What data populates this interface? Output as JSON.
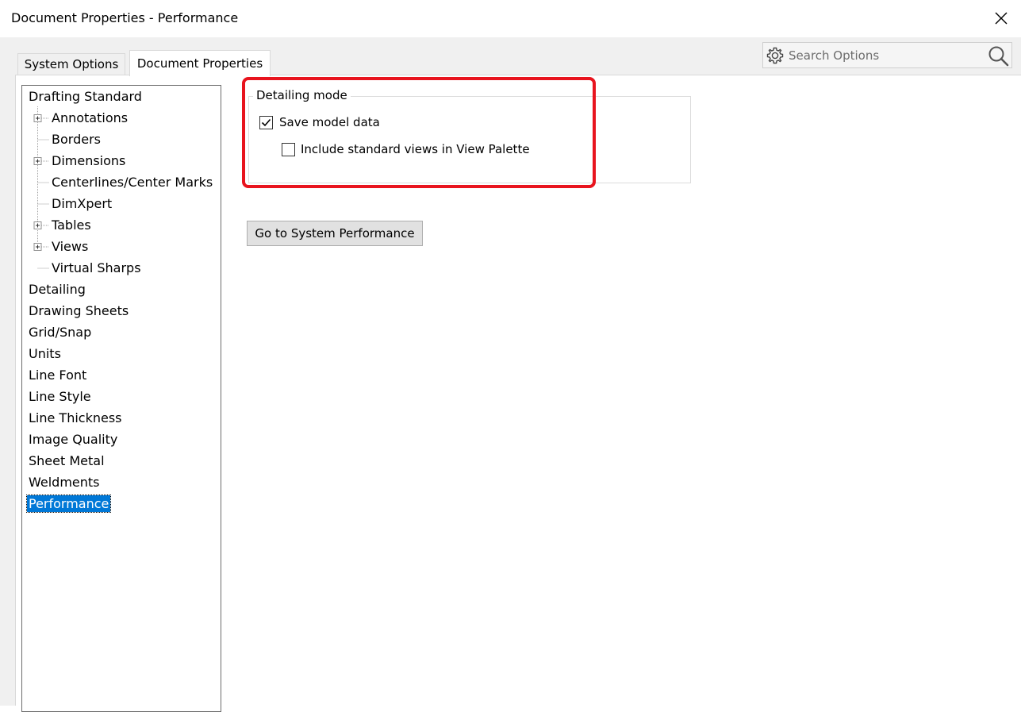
{
  "window": {
    "title": "Document Properties - Performance"
  },
  "tabs": [
    {
      "label": "System Options",
      "active": false
    },
    {
      "label": "Document Properties",
      "active": true
    }
  ],
  "search": {
    "placeholder": "Search Options"
  },
  "tree": {
    "items": [
      {
        "label": "Drafting Standard",
        "level": 0
      },
      {
        "label": "Annotations",
        "level": 1,
        "expandable": true
      },
      {
        "label": "Borders",
        "level": 1
      },
      {
        "label": "Dimensions",
        "level": 1,
        "expandable": true
      },
      {
        "label": "Centerlines/Center Marks",
        "level": 1
      },
      {
        "label": "DimXpert",
        "level": 1
      },
      {
        "label": "Tables",
        "level": 1,
        "expandable": true
      },
      {
        "label": "Views",
        "level": 1,
        "expandable": true
      },
      {
        "label": "Virtual Sharps",
        "level": 1
      },
      {
        "label": "Detailing",
        "level": 0
      },
      {
        "label": "Drawing Sheets",
        "level": 0
      },
      {
        "label": "Grid/Snap",
        "level": 0
      },
      {
        "label": "Units",
        "level": 0
      },
      {
        "label": "Line Font",
        "level": 0
      },
      {
        "label": "Line Style",
        "level": 0
      },
      {
        "label": "Line Thickness",
        "level": 0
      },
      {
        "label": "Image Quality",
        "level": 0
      },
      {
        "label": "Sheet Metal",
        "level": 0
      },
      {
        "label": "Weldments",
        "level": 0
      },
      {
        "label": "Performance",
        "level": 0,
        "selected": true
      }
    ]
  },
  "detailing_mode": {
    "title": "Detailing mode",
    "save_model_data": {
      "label": "Save model data",
      "checked": true
    },
    "include_standard_views": {
      "label": "Include standard views in View Palette",
      "checked": false
    }
  },
  "buttons": {
    "system_performance": "Go to System Performance"
  },
  "colors": {
    "highlight_border": "#e8141e",
    "selection": "#0078d7"
  }
}
